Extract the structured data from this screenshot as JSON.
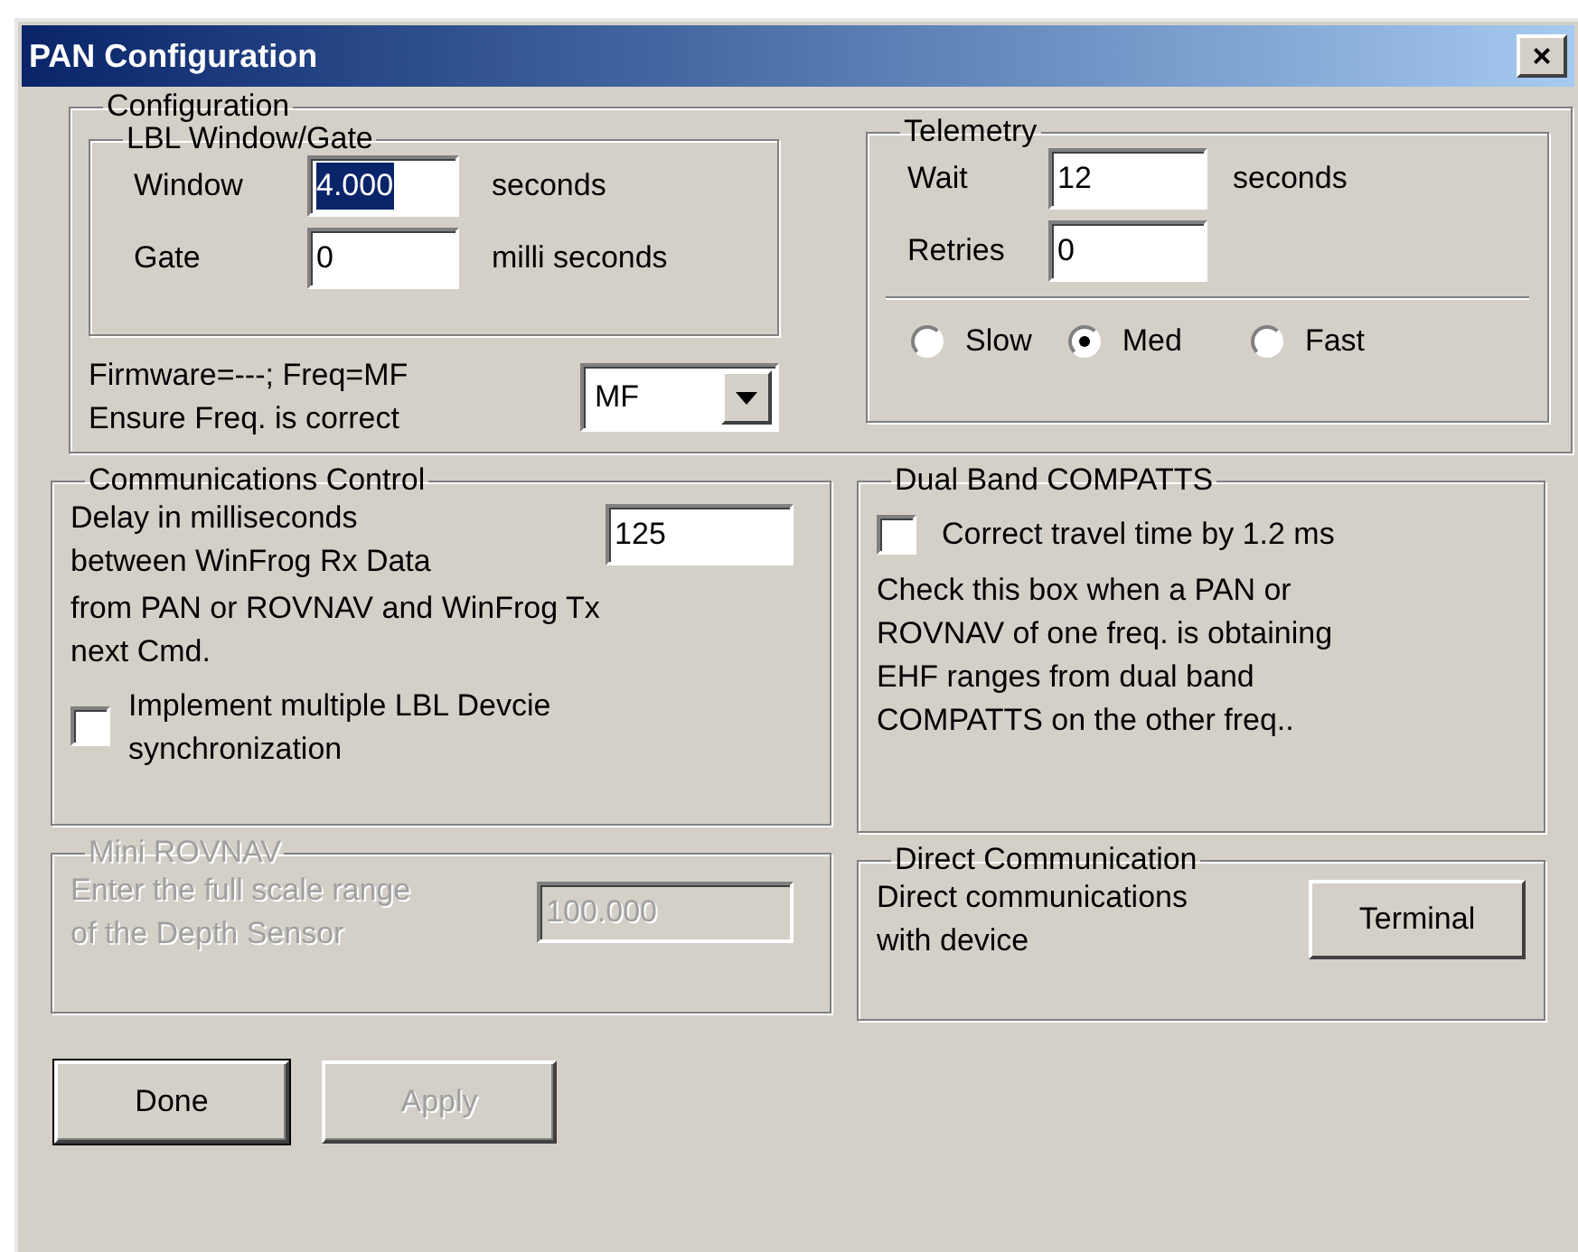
{
  "window": {
    "title": "PAN Configuration",
    "close": "×"
  },
  "configuration": {
    "title": "Configuration",
    "lbl": {
      "title": "LBL Window/Gate",
      "fields": [
        {
          "label": "Window",
          "value": "4.000",
          "unit": "seconds",
          "selected": true
        },
        {
          "label": "Gate",
          "value": "0",
          "unit": "milli seconds",
          "selected": false
        }
      ]
    },
    "firmware_lines": [
      "Firmware=---; Freq=MF",
      "Ensure Freq. is correct"
    ],
    "freq_dropdown": {
      "value": "MF"
    },
    "telemetry": {
      "title": "Telemetry",
      "fields": [
        {
          "label": "Wait",
          "value": "12",
          "unit": "seconds"
        },
        {
          "label": "Retries",
          "value": "0"
        }
      ],
      "speeds": [
        {
          "label": "Slow",
          "selected": false
        },
        {
          "label": "Med",
          "selected": true
        },
        {
          "label": "Fast",
          "selected": false
        }
      ]
    }
  },
  "communications": {
    "title": "Communications Control",
    "delay_lines": [
      "Delay in milliseconds",
      "between WinFrog Rx Data"
    ],
    "delay_value": "125",
    "delay_cont_lines": [
      "from PAN or ROVNAV and WinFrog Tx",
      "next Cmd."
    ],
    "sync_checkbox": {
      "lines": [
        "Implement multiple LBL Devcie",
        "synchronization"
      ],
      "checked": false
    }
  },
  "dual_band": {
    "title": "Dual Band COMPATTS",
    "checkbox": {
      "label": "Correct travel time by 1.2 ms",
      "checked": false
    },
    "description_lines": [
      "Check this box when a PAN or",
      "ROVNAV of one freq. is obtaining",
      "EHF ranges from dual band",
      "COMPATTS on the other freq.."
    ]
  },
  "mini_rovnav": {
    "title": "Mini ROVNAV",
    "description_lines": [
      "Enter the full scale range",
      "of the Depth Sensor"
    ],
    "value": "100.000",
    "disabled": true
  },
  "direct": {
    "title": "Direct Communication",
    "description_lines": [
      "Direct communications",
      "with device"
    ],
    "button": "Terminal"
  },
  "buttons": [
    {
      "label": "Done",
      "disabled": false,
      "default": true
    },
    {
      "label": "Apply",
      "disabled": true,
      "default": false
    }
  ]
}
